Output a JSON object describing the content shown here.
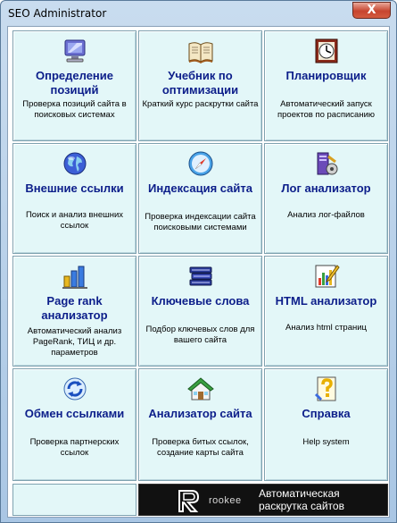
{
  "window": {
    "title": "SEO Administrator",
    "close_label": "X"
  },
  "tiles": [
    {
      "title": "Определение позиций",
      "desc": "Проверка позиций сайта в поисковых системах",
      "icon": "monitor-icon"
    },
    {
      "title": "Учебник по оптимизации",
      "desc": "Краткий курс раскрутки сайта",
      "icon": "book-icon"
    },
    {
      "title": "Планировщик",
      "desc": "Автоматический запуск проектов по расписанию",
      "icon": "clock-icon"
    },
    {
      "title": "Внешние ссылки",
      "desc": "Поиск и анализ внешних ссылок",
      "icon": "globe-icon"
    },
    {
      "title": "Индексация сайта",
      "desc": "Проверка индексации сайта поисковыми системами",
      "icon": "compass-icon"
    },
    {
      "title": "Лог анализатор",
      "desc": "Анализ лог-файлов",
      "icon": "server-icon"
    },
    {
      "title": "Page rank анализатор",
      "desc": "Автоматический анализ PageRank, ТИЦ и др. параметров",
      "icon": "bar-chart-icon"
    },
    {
      "title": "Ключевые слова",
      "desc": "Подбор ключевых слов для вашего сайта",
      "icon": "books-stack-icon"
    },
    {
      "title": "HTML анализатор",
      "desc": "Анализ html страниц",
      "icon": "chart-pencil-icon"
    },
    {
      "title": "Обмен ссылками",
      "desc": "Проверка партнерских ссылок",
      "icon": "refresh-icon"
    },
    {
      "title": "Анализатор сайта",
      "desc": "Проверка битых ссылок, создание карты сайта",
      "icon": "house-icon"
    },
    {
      "title": "Справка",
      "desc": "Help system",
      "icon": "help-icon"
    }
  ],
  "banner": {
    "brand": "rookee",
    "slogan": "Автоматическая раскрутка сайтов"
  }
}
